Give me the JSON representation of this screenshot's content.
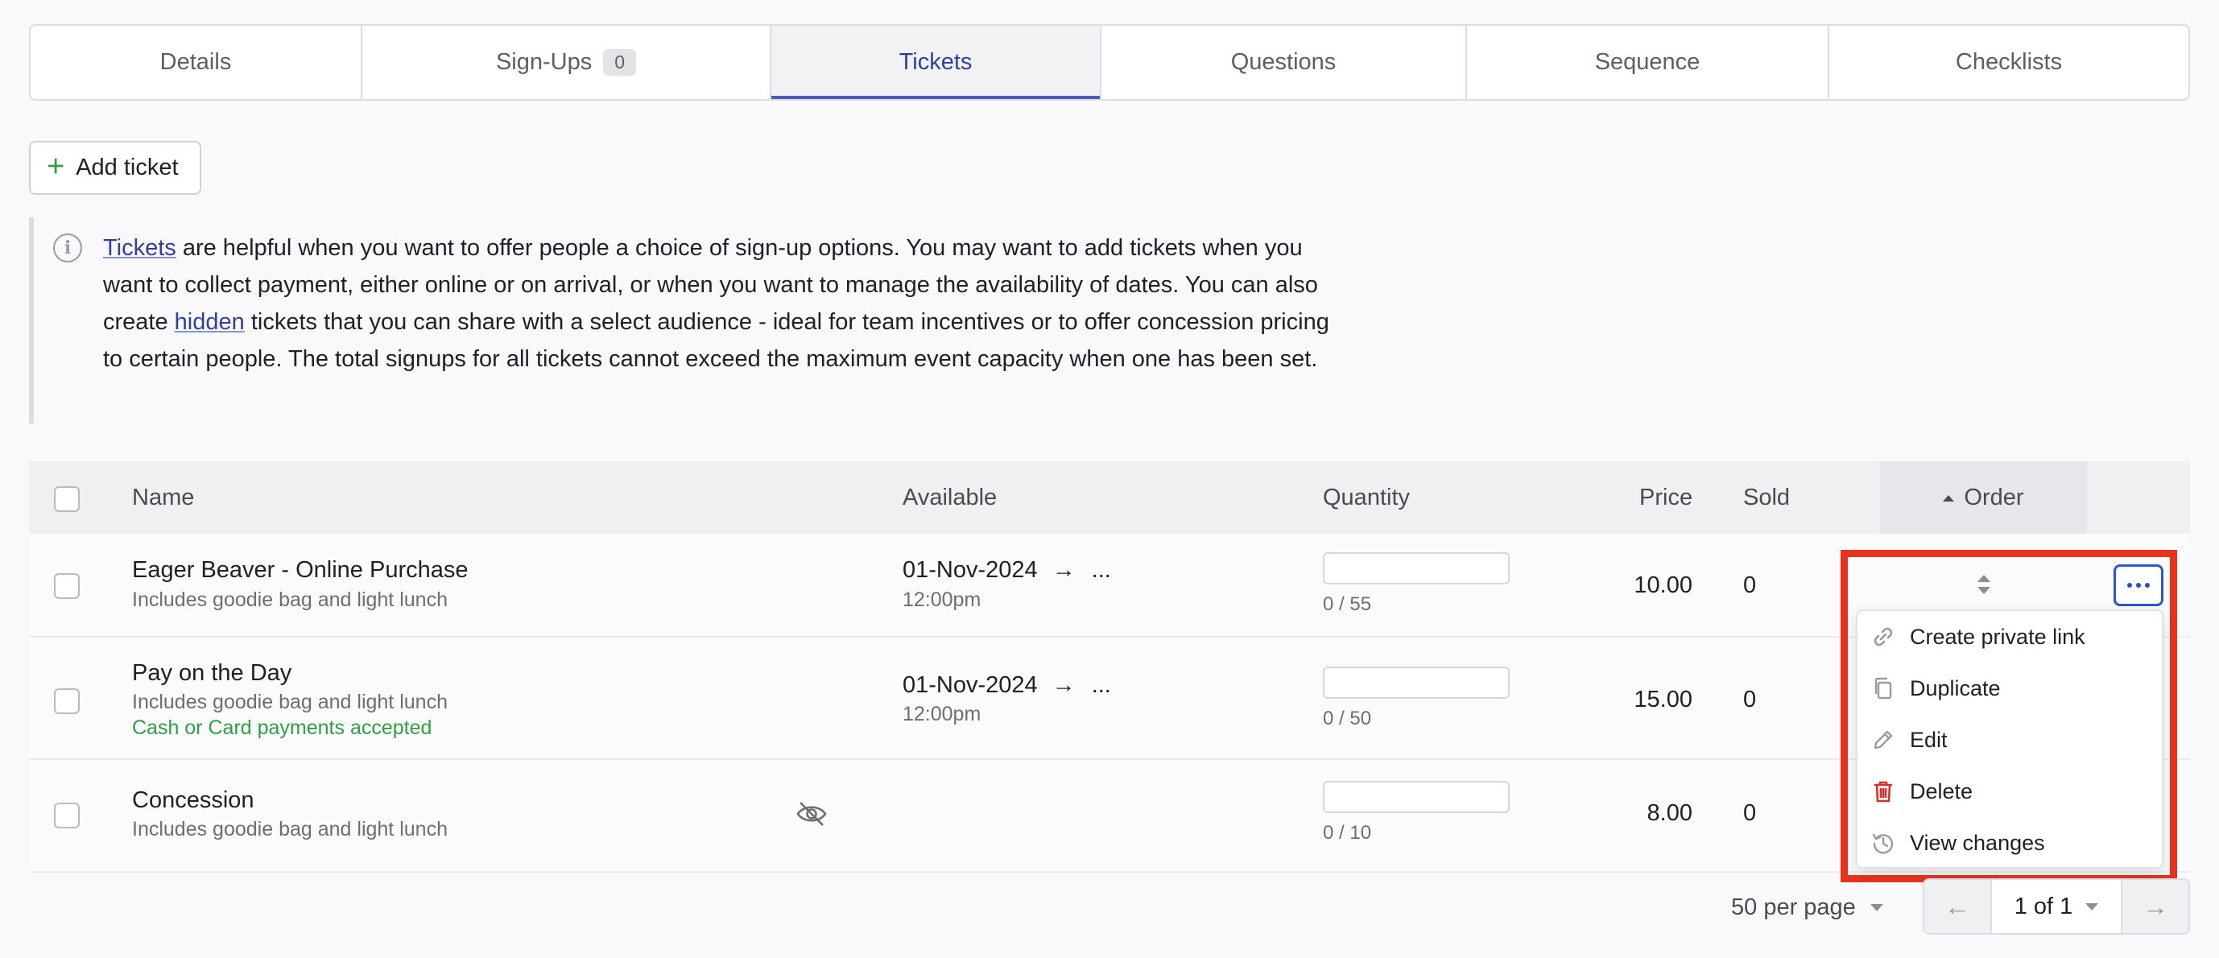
{
  "tabs": [
    {
      "label": "Details"
    },
    {
      "label": "Sign-Ups",
      "badge": "0"
    },
    {
      "label": "Tickets",
      "active": true
    },
    {
      "label": "Questions"
    },
    {
      "label": "Sequence"
    },
    {
      "label": "Checklists"
    }
  ],
  "toolbar": {
    "add_ticket_label": "Add ticket"
  },
  "info": {
    "link_tickets": "Tickets",
    "part1": " are helpful when you want to offer people a choice of sign-up options. You may want to add tickets when you want to collect payment, either online or on arrival, or when you want to manage the availability of dates. You can also create ",
    "link_hidden": "hidden",
    "part2": " tickets that you can share with a select audience - ideal for team incentives or to offer concession pricing to certain people. The total signups for all tickets cannot exceed the maximum event capacity when one has been set."
  },
  "table": {
    "headers": {
      "name": "Name",
      "available": "Available",
      "quantity": "Quantity",
      "price": "Price",
      "sold": "Sold",
      "order": "Order"
    },
    "rows": [
      {
        "name": "Eager Beaver - Online Purchase",
        "desc": "Includes goodie bag and light lunch",
        "note": "",
        "available_date": "01-Nov-2024",
        "available_more": "...",
        "available_time": "12:00pm",
        "qty": "0 / 55",
        "price": "10.00",
        "sold": "0",
        "hidden": false
      },
      {
        "name": "Pay on the Day",
        "desc": "Includes goodie bag and light lunch",
        "note": "Cash or Card payments accepted",
        "available_date": "01-Nov-2024",
        "available_more": "...",
        "available_time": "12:00pm",
        "qty": "0 / 50",
        "price": "15.00",
        "sold": "0",
        "hidden": false
      },
      {
        "name": "Concession",
        "desc": "Includes goodie bag and light lunch",
        "note": "",
        "available_date": "",
        "available_more": "",
        "available_time": "",
        "qty": "0 / 10",
        "price": "8.00",
        "sold": "0",
        "hidden": true
      }
    ]
  },
  "menu": {
    "items": [
      {
        "label": "Create private link",
        "icon": "link-icon"
      },
      {
        "label": "Duplicate",
        "icon": "duplicate-icon"
      },
      {
        "label": "Edit",
        "icon": "pencil-icon"
      },
      {
        "label": "Delete",
        "icon": "trash-icon"
      },
      {
        "label": "View changes",
        "icon": "history-icon"
      }
    ]
  },
  "pagination": {
    "per_page": "50 per page",
    "page": "1 of 1"
  },
  "colors": {
    "accent": "#4b5ab8",
    "highlight": "#e8321c",
    "delete": "#d6312b",
    "success": "#2f9e44"
  }
}
